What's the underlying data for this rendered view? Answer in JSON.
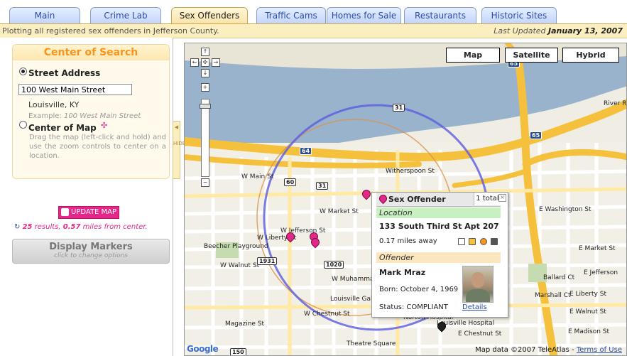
{
  "tabs": [
    {
      "label": "Main"
    },
    {
      "label": "Crime Lab"
    },
    {
      "label": "Sex Offenders"
    },
    {
      "label": "Traffic Cams"
    },
    {
      "label": "Homes for Sale"
    },
    {
      "label": "Restaurants"
    },
    {
      "label": "Historic Sites"
    }
  ],
  "active_tab": "Sex Offenders",
  "status": {
    "description": "Plotting all registered sex offenders in Jefferson County.",
    "updated_prefix": "Last Updated",
    "updated_date": "January 13, 2007"
  },
  "search": {
    "title": "Center of Search",
    "street_option_label": "Street Address",
    "address_value": "100 West Main Street",
    "city_state": "Louisville, KY",
    "example_prefix": "Example:",
    "example_value": "100 West Main Street",
    "center_option_label": "Center of Map",
    "center_description": "Drag the map (left-click and hold) and use the zoom controls to center on a location.",
    "selected_option": "street"
  },
  "update_button_label": "UPDATE MAP",
  "results": {
    "count": "25",
    "count_suffix": "results,",
    "distance": "0.57",
    "distance_suffix": "miles from center."
  },
  "display_markers": {
    "label": "Display Markers",
    "sublabel": "click to change options"
  },
  "hide_strip_label": "HIDE",
  "map": {
    "type_buttons": [
      "Map",
      "Satellite",
      "Hybrid"
    ],
    "attribution_prefix": "Map data ©2007 TeleAtlas -",
    "terms_link": "Terms of Use",
    "logo": "Google",
    "street_labels": [
      "W Main St",
      "W Market St",
      "W Jefferson St",
      "W Liberty St",
      "W Muhammad",
      "W Chestnut St",
      "Witherspoon St",
      "E Washington St",
      "E Market St",
      "E Jefferson",
      "E Liberty St",
      "E Walnut St",
      "E Madison St",
      "E Chestnut St",
      "W Walnut St",
      "Magazine St",
      "Theatre Square",
      "Beecher Playground",
      "River Rd",
      "Louisville Galleria",
      "Norton Hospital",
      "Louisville Hospital",
      "Marshall Ct",
      "Ballard Ct"
    ],
    "route_shields": [
      "65",
      "64",
      "31",
      "60",
      "31",
      "1931",
      "1020",
      "150",
      "65"
    ]
  },
  "popup": {
    "icon": "pink-marker-icon",
    "title": "Sex Offender",
    "count": "1 total",
    "location_header": "Location",
    "address": "133 South Third St Apt 207",
    "distance": "0.17 miles away",
    "offender_header": "Offender",
    "name": "Mark Mraz",
    "born": "Born: October 4, 1969",
    "status": "Status: COMPLIANT",
    "details_link": "Details"
  },
  "colors": {
    "accent_pink": "#e3288a",
    "accent_orange": "#f7941d",
    "status_bar": "#fbefbf",
    "search_circle": "#5b5be0",
    "location_header_bg": "#c9f0c0",
    "offender_header_bg": "#fbe6bd"
  }
}
